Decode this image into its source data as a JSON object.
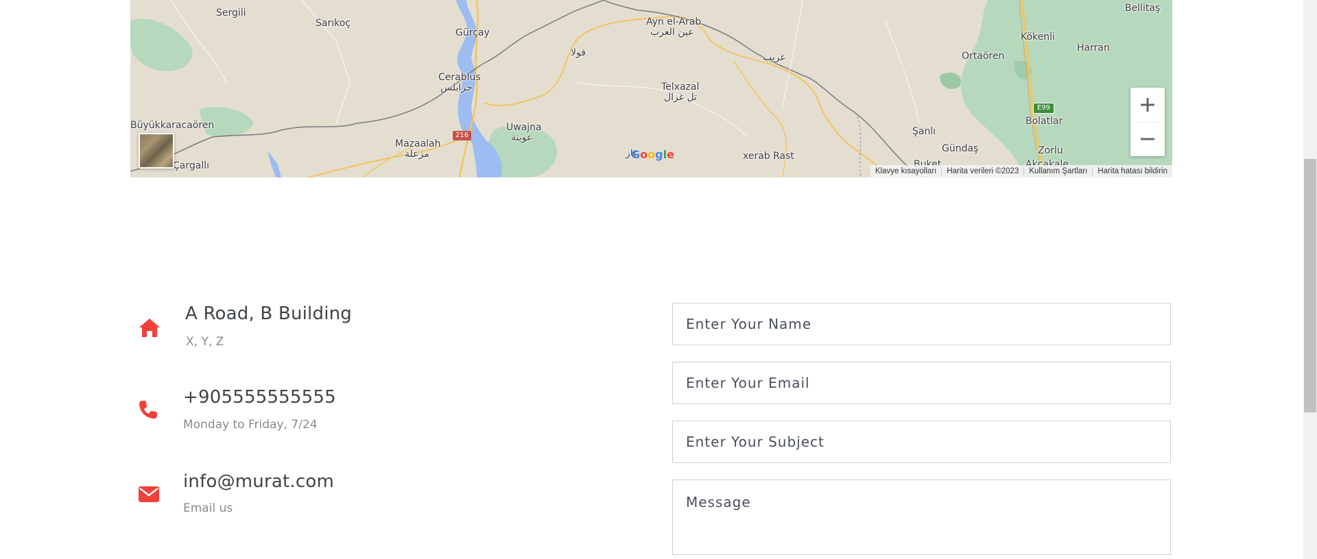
{
  "map": {
    "places": [
      {
        "id": "sergili",
        "text": "Sergili"
      },
      {
        "id": "sarikoc",
        "text": "Sarıkoç"
      },
      {
        "id": "gurcay",
        "text": "Gürçay"
      },
      {
        "id": "ayn-el-arab",
        "text": "Ayn el-Arab"
      },
      {
        "id": "ayn-el-arab-ar",
        "text": "عين العرب"
      },
      {
        "id": "fula",
        "text": "فولا"
      },
      {
        "id": "gharib",
        "text": "غريب"
      },
      {
        "id": "kokenli",
        "text": "Kökenli"
      },
      {
        "id": "bellitas",
        "text": "Bellitaş"
      },
      {
        "id": "ortaoren",
        "text": "Ortaören"
      },
      {
        "id": "harran",
        "text": "Harran"
      },
      {
        "id": "cerablus",
        "text": "Cerablus"
      },
      {
        "id": "cerablus-ar",
        "text": "جرابلس"
      },
      {
        "id": "telxazal",
        "text": "Telxazal"
      },
      {
        "id": "telxazal-ar",
        "text": "تل غزال"
      },
      {
        "id": "sanli",
        "text": "Şanlı"
      },
      {
        "id": "bolatlar",
        "text": "Bolatlar"
      },
      {
        "id": "buyukkaracaoren",
        "text": "Büyükkaracaören"
      },
      {
        "id": "uwajna",
        "text": "Uwajna"
      },
      {
        "id": "uwajna-ar",
        "text": "عوينة"
      },
      {
        "id": "mazaalah",
        "text": "Mazaalah"
      },
      {
        "id": "mazaalah-ar",
        "text": "مزعلة"
      },
      {
        "id": "gundas",
        "text": "Gündaş"
      },
      {
        "id": "zorlu",
        "text": "Zorlu"
      },
      {
        "id": "xerab-rast",
        "text": "xerab Rast"
      },
      {
        "id": "cargalli",
        "text": "Çargallı"
      },
      {
        "id": "buket",
        "text": "Buket"
      },
      {
        "id": "akcakale",
        "text": "Akçakale"
      },
      {
        "id": "ghaz",
        "text": "غاز"
      }
    ],
    "road_badge": "216",
    "e_badge": "E99",
    "google_logo": "Google",
    "zoom_in": "+",
    "zoom_out": "−",
    "attribution": [
      "Klavye kısayolları",
      "Harita verileri ©2023",
      "Kullanım Şartları",
      "Harita hatası bildirin"
    ]
  },
  "contact": {
    "address": {
      "title": "A Road, B Building",
      "sub": "X, Y, Z"
    },
    "phone": {
      "title": "+905555555555",
      "sub": "Monday to Friday, 7/24"
    },
    "email": {
      "title": "info@murat.com",
      "sub": "Email us"
    }
  },
  "form": {
    "name_placeholder": "Enter Your Name",
    "email_placeholder": "Enter Your Email",
    "subject_placeholder": "Enter Your Subject",
    "message_placeholder": "Message"
  },
  "colors": {
    "accent": "#f0413b",
    "map_bg": "#e4ded1",
    "park": "#a8d5b5",
    "water": "#9ab9f0",
    "road": "#f3c45f"
  }
}
